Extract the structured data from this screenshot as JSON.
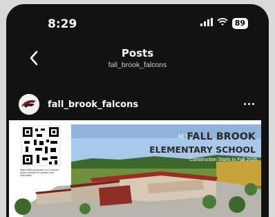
{
  "status_bar": {
    "time": "8:29",
    "battery": "89",
    "icons": [
      "cellular-signal-icon",
      "wifi-icon",
      "battery-icon"
    ]
  },
  "header": {
    "title": "Posts",
    "subtitle": "fall_brook_falcons",
    "back_icon": "chevron-left-icon"
  },
  "post": {
    "username": "fall_brook_falcons",
    "more_icon": "more-horizontal-icon",
    "image": {
      "headline_prefix": "All 'is",
      "headline_line1": "FALL BROOK",
      "headline_line2": "ELEMENTARY SCHOOL",
      "caption": "Construction Starts in Fall 2026",
      "qr_text": "https://fallbrookproject.com/ Visit the project website for updates and information"
    }
  },
  "colors": {
    "background": "#121212",
    "text": "#ffffff",
    "sky": "#a9c7e8",
    "roof": "#9b2d25"
  }
}
